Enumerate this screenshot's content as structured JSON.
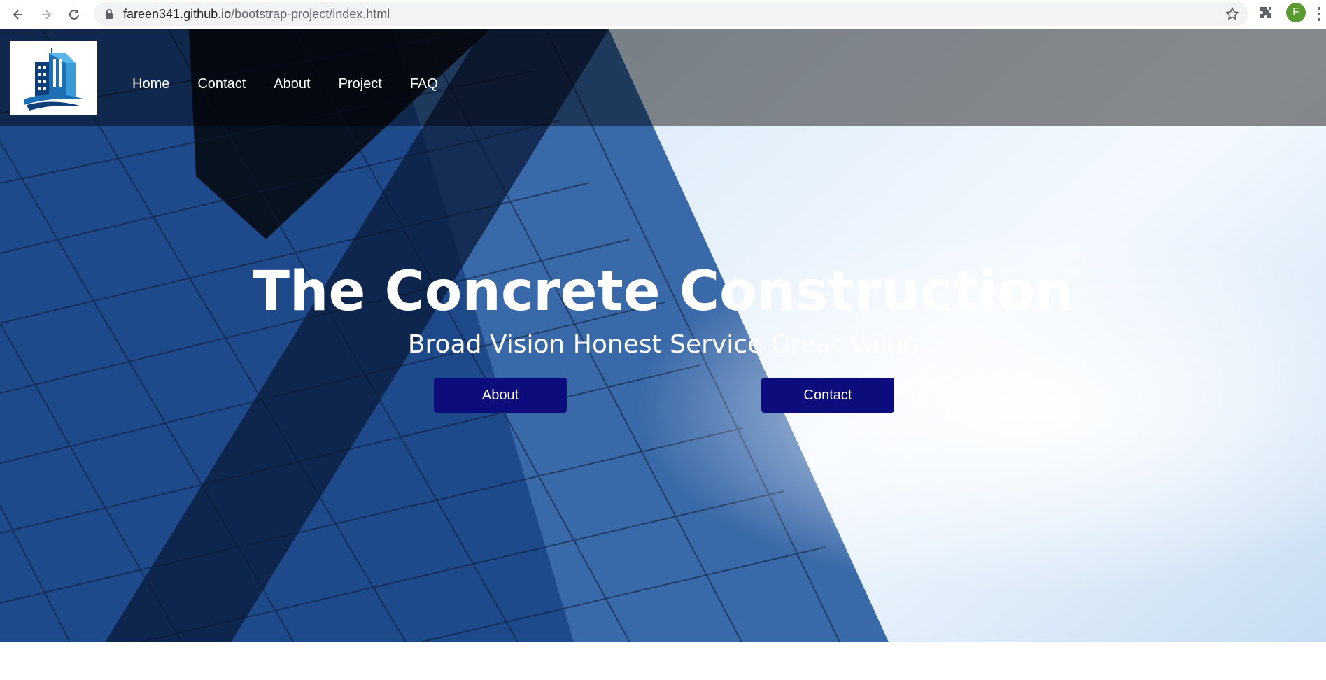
{
  "browser": {
    "url_host": "fareen341.github.io",
    "url_path": "/bootstrap-project/index.html",
    "profile_initial": "F",
    "icons": [
      "back-icon",
      "forward-icon",
      "reload-icon",
      "lock-icon",
      "star-icon",
      "extensions-icon",
      "more-icon"
    ]
  },
  "nav": {
    "items": [
      {
        "label": "Home"
      },
      {
        "label": "Contact"
      },
      {
        "label": "About"
      },
      {
        "label": "Project"
      },
      {
        "label": "FAQ"
      }
    ]
  },
  "hero": {
    "title": "The Concrete Construction",
    "subtitle": "Broad Vision Honest Service Great Value",
    "buttons": {
      "about": "About",
      "contact": "Contact"
    },
    "button_color": "#0c0c7c"
  }
}
